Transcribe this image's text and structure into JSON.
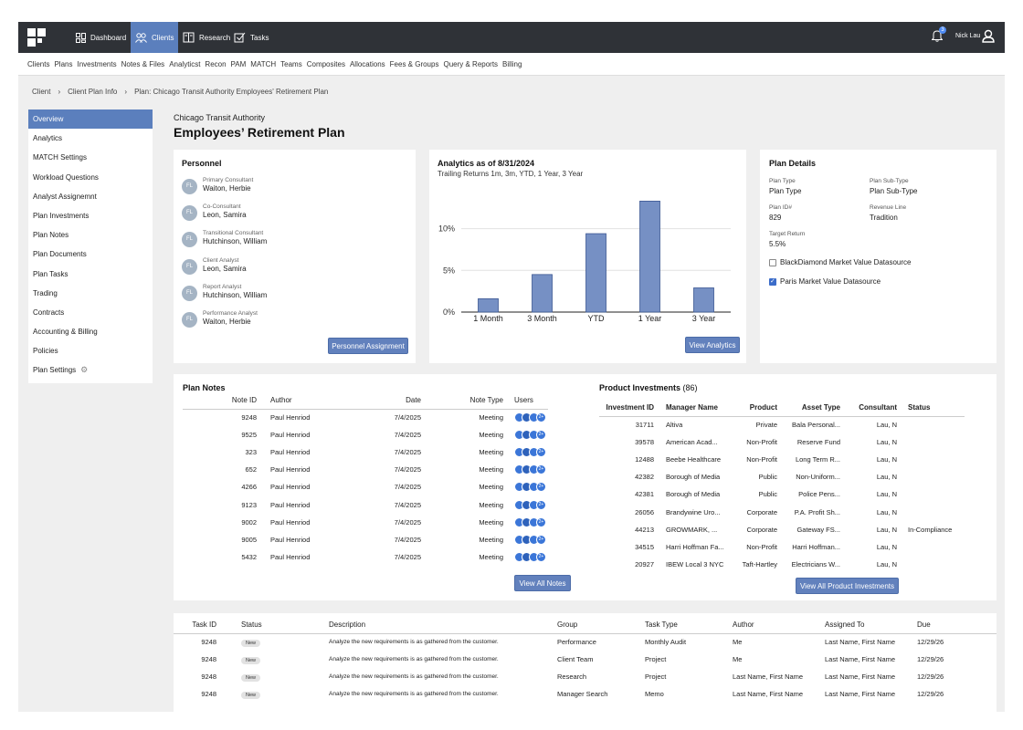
{
  "topnav": {
    "tabs": [
      {
        "label": "Dashboard",
        "icon": "dashboard-grid-icon"
      },
      {
        "label": "Clients",
        "icon": "people-icon",
        "active": true
      },
      {
        "label": "Research",
        "icon": "research-book-icon"
      },
      {
        "label": "Tasks",
        "icon": "tasks-check-icon"
      }
    ],
    "notifications_count": "3",
    "user_name": "Nick Lau"
  },
  "menubar": [
    "Clients",
    "Plans",
    "Investments",
    "Notes & Files",
    "Analyticst",
    "Recon",
    "PAM",
    "MATCH",
    "Teams",
    "Composites",
    "Allocations",
    "Fees & Groups",
    "Query & Reports",
    "Billing"
  ],
  "breadcrumb": [
    "Client",
    "Client Plan Info",
    "Plan: Chicago Transit Authority Employees' Retirement Plan"
  ],
  "sidebar": [
    {
      "label": "Overview",
      "active": true
    },
    {
      "label": "Analytics"
    },
    {
      "label": "MATCH Settings"
    },
    {
      "label": "Workload Questions"
    },
    {
      "label": "Analyst Assignemnt"
    },
    {
      "label": "Plan Investments"
    },
    {
      "label": "Plan Notes"
    },
    {
      "label": "Plan Documents"
    },
    {
      "label": "Plan Tasks"
    },
    {
      "label": "Trading"
    },
    {
      "label": "Contracts"
    },
    {
      "label": "Accounting & Billing"
    },
    {
      "label": "Policies"
    },
    {
      "label": "Plan Settings"
    }
  ],
  "plan": {
    "org": "Chicago Transit Authority",
    "title": "Employees’ Retirement Plan"
  },
  "personnel": {
    "title": "Personnel",
    "people": [
      {
        "initials": "FL",
        "role": "Primary Consultant",
        "name": "Waiton, Herbie"
      },
      {
        "initials": "FL",
        "role": "Co-Consultant",
        "name": "Leon, Samira"
      },
      {
        "initials": "FL",
        "role": "Transitional Consultant",
        "name": "Hutchinson, William"
      },
      {
        "initials": "FL",
        "role": "Client Analyst",
        "name": "Leon, Samira"
      },
      {
        "initials": "FL",
        "role": "Report Analyst",
        "name": "Hutchinson, William"
      },
      {
        "initials": "FL",
        "role": "Performance Analyst",
        "name": "Waiton, Herbie"
      }
    ],
    "button": "Personnel Assignment"
  },
  "analytics": {
    "title": "Analytics as of 8/31/2024",
    "subtitle": "Trailing Returns 1m, 3m, YTD, 1 Year, 3 Year",
    "button": "View Analytics"
  },
  "chart_data": {
    "type": "bar",
    "categories": [
      "1 Month",
      "3 Month",
      "YTD",
      "1 Year",
      "3 Year"
    ],
    "values": [
      1.6,
      4.5,
      9.4,
      13.3,
      2.9
    ],
    "ylim": [
      0,
      14
    ],
    "yticks": [
      "0%",
      "5%",
      "10%"
    ],
    "ytick_values": [
      0,
      5,
      10
    ],
    "grid": true,
    "bar_color": "#7690c4"
  },
  "plan_details": {
    "title": "Plan Details",
    "fields": [
      {
        "label": "Plan Type",
        "value": "Plan Type"
      },
      {
        "label": "Plan Sub-Type",
        "value": "Plan Sub-Type"
      },
      {
        "label": "Plan ID#",
        "value": "829"
      },
      {
        "label": "Revenue Line",
        "value": "Tradition"
      },
      {
        "label": "Target Return",
        "value": "5.5%"
      }
    ],
    "checkboxes": [
      {
        "label": "BlackDiamond Market Value Datasource",
        "checked": false
      },
      {
        "label": "Paris Market Value Datasource",
        "checked": true
      }
    ]
  },
  "plan_notes": {
    "title": "Plan Notes",
    "columns": [
      "Note ID",
      "Author",
      "Date",
      "Note Type",
      "Users"
    ],
    "rows": [
      [
        "9248",
        "Paul Henriod",
        "7/4/2025",
        "Meeting"
      ],
      [
        "9525",
        "Paul Henriod",
        "7/4/2025",
        "Meeting"
      ],
      [
        "323",
        "Paul Henriod",
        "7/4/2025",
        "Meeting"
      ],
      [
        "652",
        "Paul Henriod",
        "7/4/2025",
        "Meeting"
      ],
      [
        "4266",
        "Paul Henriod",
        "7/4/2025",
        "Meeting"
      ],
      [
        "9123",
        "Paul Henriod",
        "7/4/2025",
        "Meeting"
      ],
      [
        "9002",
        "Paul Henriod",
        "7/4/2025",
        "Meeting"
      ],
      [
        "9005",
        "Paul Henriod",
        "7/4/2025",
        "Meeting"
      ],
      [
        "5432",
        "Paul Henriod",
        "7/4/2025",
        "Meeting"
      ]
    ],
    "users_more": "2+",
    "button": "View All Notes"
  },
  "product_investments": {
    "title": "Product Investments",
    "count": "(86)",
    "columns": [
      "Investment ID",
      "Manager Name",
      "Product",
      "Asset Type",
      "Consultant",
      "Status"
    ],
    "rows": [
      [
        "31711",
        "Altiva",
        "Private",
        "Bala Personal...",
        "Lau, N",
        ""
      ],
      [
        "39578",
        "American Acad...",
        "Non-Profit",
        "Reserve Fund",
        "Lau, N",
        ""
      ],
      [
        "12488",
        "Beebe Healthcare",
        "Non-Profit",
        "Long Term R...",
        "Lau, N",
        ""
      ],
      [
        "42382",
        "Borough of Media",
        "Public",
        "Non-Uniform...",
        "Lau, N",
        ""
      ],
      [
        "42381",
        "Borough of Media",
        "Public",
        "Police Pens...",
        "Lau, N",
        ""
      ],
      [
        "26056",
        "Brandywine Uro...",
        "Corporate",
        "P.A. Profit Sh...",
        "Lau, N",
        ""
      ],
      [
        "44213",
        "GROWMARK, ...",
        "Corporate",
        "Gateway FS...",
        "Lau, N",
        "In-Compliance"
      ],
      [
        "34515",
        "Harri Hoffman Fa...",
        "Non-Profit",
        "Harri Hoffman...",
        "Lau, N",
        ""
      ],
      [
        "20927",
        "IBEW Local 3 NYC",
        "Taft-Hartley",
        "Electricians W...",
        "Lau, N",
        ""
      ]
    ],
    "button": "View All Product Investments"
  },
  "tasks": {
    "columns": [
      "Task ID",
      "Status",
      "Description",
      "Group",
      "Task Type",
      "Author",
      "Assigned To",
      "Due"
    ],
    "rows": [
      [
        "9248",
        "New",
        "Analyze the new requirements is as gathered from the customer.",
        "Performance",
        "Monthly Audit",
        "Me",
        "Last Name, First Name",
        "12/29/26"
      ],
      [
        "9248",
        "New",
        "Analyze the new requirements is as gathered from the customer.",
        "Client Team",
        "Project",
        "Me",
        "Last Name, First Name",
        "12/29/26"
      ],
      [
        "9248",
        "New",
        "Analyze the new requirements is as gathered from the customer.",
        "Research",
        "Project",
        "Last Name, First Name",
        "Last Name, First Name",
        "12/29/26"
      ],
      [
        "9248",
        "New",
        "Analyze the new requirements is as gathered from the customer.",
        "Manager Search",
        "Memo",
        "Last Name, First Name",
        "Last Name, First Name",
        "12/29/26"
      ]
    ]
  }
}
